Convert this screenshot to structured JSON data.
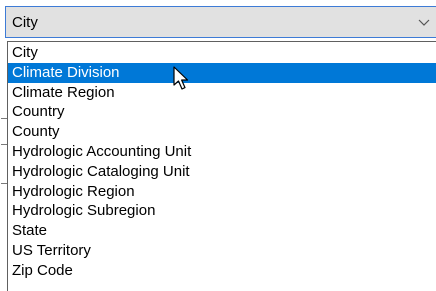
{
  "combo": {
    "selected_value": "City"
  },
  "dropdown": {
    "options": [
      "City",
      "Climate Division",
      "Climate Region",
      "Country",
      "County",
      "Hydrologic Accounting Unit",
      "Hydrologic Cataloging Unit",
      "Hydrologic Region",
      "Hydrologic Subregion",
      "State",
      "US Territory",
      "Zip Code"
    ],
    "highlighted_index": 1
  },
  "colors": {
    "highlight": "#0078d7",
    "combo_border": "#3d7bd6",
    "combo_background": "#e1e1e1"
  },
  "icons": {
    "combo_arrow": "chevron-down-icon",
    "cursor": "mouse-pointer-icon"
  }
}
